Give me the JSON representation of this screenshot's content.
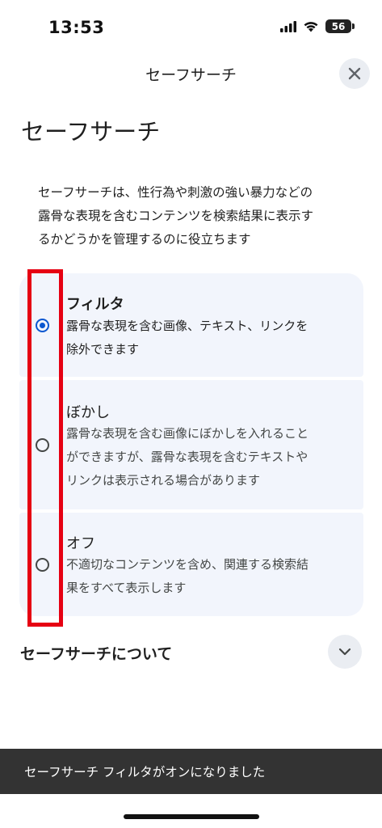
{
  "status_bar": {
    "time": "13:53",
    "battery": "56",
    "icons": [
      "cellular-signal-icon",
      "wifi-icon",
      "battery-icon"
    ]
  },
  "header": {
    "title": "セーフサーチ",
    "close_icon": "close-icon"
  },
  "page": {
    "title": "セーフサーチ",
    "description_lines": [
      "セーフサーチは、性行為や刺激の強い暴力などの",
      "露骨な表現を含むコンテンツを検索結果に表示す",
      "るかどうかを管理するのに役立ちます"
    ]
  },
  "options": [
    {
      "label": "フィルタ",
      "selected": true,
      "description_lines": [
        "露骨な表現を含む画像、テキスト、リンクを",
        "除外できます"
      ]
    },
    {
      "label": "ぼかし",
      "selected": false,
      "description_lines": [
        "露骨な表現を含む画像にぼかしを入れること",
        "ができますが、露骨な表現を含むテキストや",
        "リンクは表示される場合があります"
      ]
    },
    {
      "label": "オフ",
      "selected": false,
      "description_lines": [
        "不適切なコンテンツを含め、関連する検索結",
        "果をすべて表示します"
      ]
    }
  ],
  "about": {
    "label": "セーフサーチについて",
    "expand_icon": "chevron-down-icon"
  },
  "snackbar": {
    "text": "セーフサーチ フィルタがオンになりました"
  },
  "colors": {
    "accent": "#0b57d0",
    "option_background": "#f2f5fc",
    "highlight": "#e60012",
    "snackbar": "#333333"
  }
}
